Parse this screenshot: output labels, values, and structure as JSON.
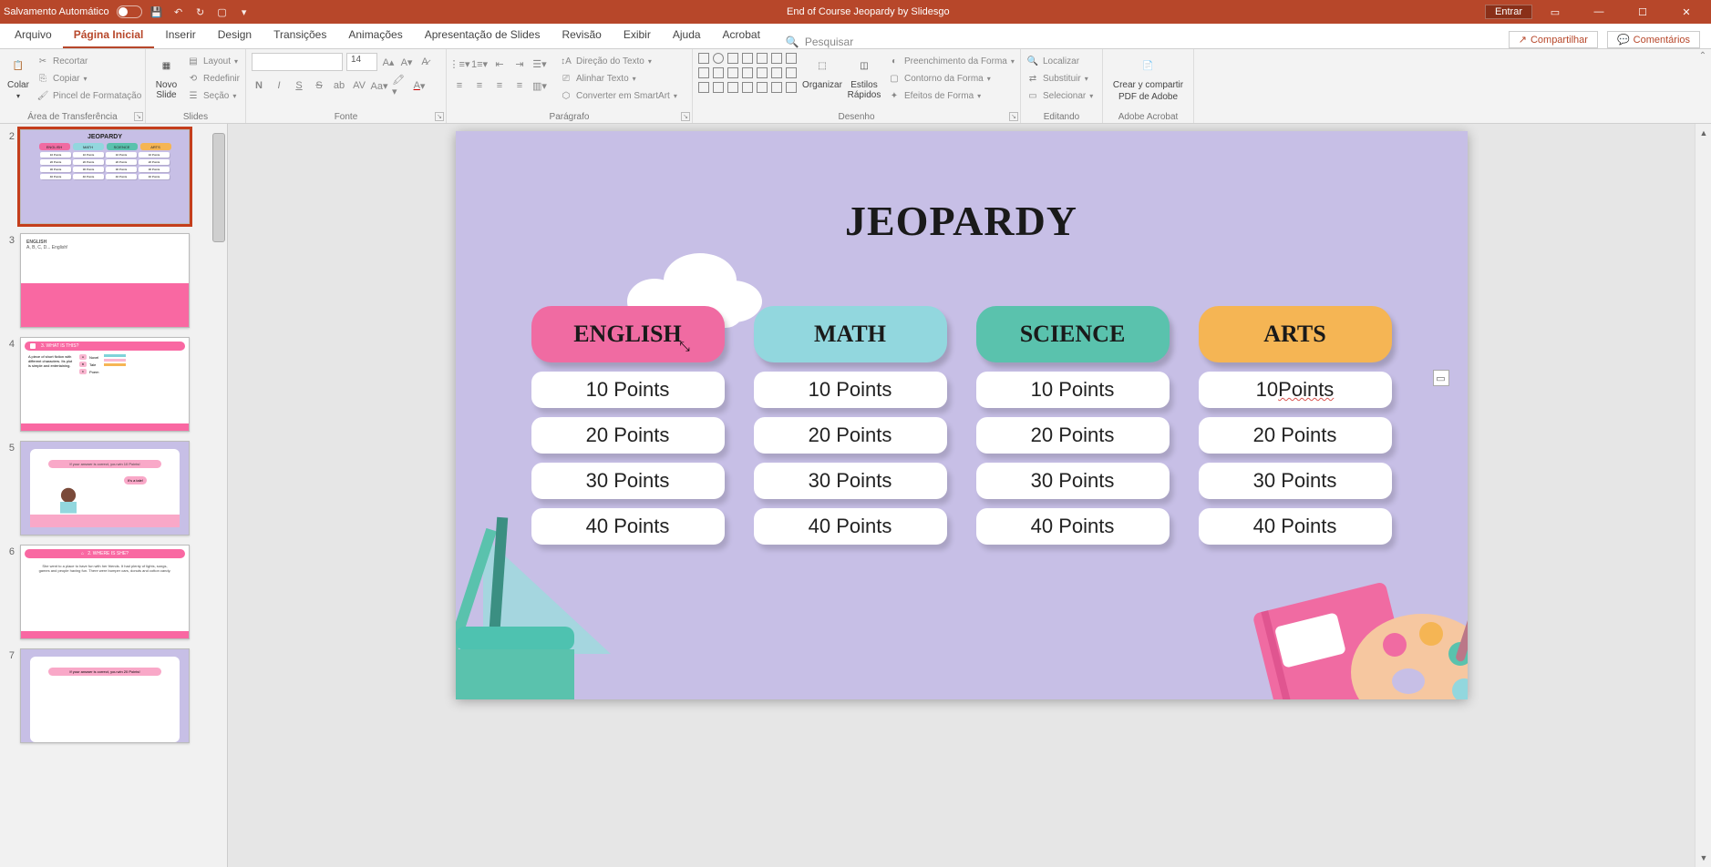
{
  "titlebar": {
    "autosave_label": "Salvamento Automático",
    "doc_title": "End of Course Jeopardy by Slidesgo",
    "signin": "Entrar"
  },
  "tabs": {
    "items": [
      "Arquivo",
      "Página Inicial",
      "Inserir",
      "Design",
      "Transições",
      "Animações",
      "Apresentação de Slides",
      "Revisão",
      "Exibir",
      "Ajuda",
      "Acrobat"
    ],
    "active_index": 1,
    "search_placeholder": "Pesquisar",
    "share": "Compartilhar",
    "comments": "Comentários"
  },
  "ribbon": {
    "clipboard": {
      "label": "Área de Transferência",
      "paste": "Colar",
      "cut": "Recortar",
      "copy": "Copiar",
      "format_painter": "Pincel de Formatação"
    },
    "slides": {
      "label": "Slides",
      "new_slide": "Novo Slide",
      "layout": "Layout",
      "reset": "Redefinir",
      "section": "Seção"
    },
    "font": {
      "label": "Fonte",
      "size": "14"
    },
    "paragraph": {
      "label": "Parágrafo",
      "text_direction": "Direção do Texto",
      "align_text": "Alinhar Texto",
      "smartart": "Converter em SmartArt"
    },
    "drawing": {
      "label": "Desenho",
      "arrange": "Organizar",
      "quick_styles": "Estilos Rápidos",
      "shape_fill": "Preenchimento da Forma",
      "shape_outline": "Contorno da Forma",
      "shape_effects": "Efeitos de Forma"
    },
    "editing": {
      "label": "Editando",
      "find": "Localizar",
      "replace": "Substituir",
      "select": "Selecionar"
    },
    "acrobat": {
      "label": "Adobe Acrobat",
      "create_pdf_l1": "Crear y compartir",
      "create_pdf_l2": "PDF de Adobe"
    }
  },
  "thumbs": {
    "list": [
      {
        "num": "2",
        "title": "JEOPARDY",
        "cats": [
          "ENGLISH",
          "MATH",
          "SCIENCE",
          "ARTS"
        ],
        "pts": [
          "10 Points",
          "20 Points",
          "30 Points",
          "40 Points"
        ]
      },
      {
        "num": "3",
        "title": "ENGLISH",
        "sub": "A, B, C, D... English!"
      },
      {
        "num": "4",
        "title": "3. WHAT IS THIS?",
        "desc": "A piece of short fiction with different characters. Its plot is simple and entertaining.",
        "opts": [
          "Novel",
          "Tale",
          "Poem"
        ]
      },
      {
        "num": "5",
        "banner": "If your answer is correct, you win 10 Points!",
        "bubble": "It's a tale!"
      },
      {
        "num": "6",
        "title": "2. WHERE IS SHE?",
        "body": "She went to a place to have fun with her friends. It had plenty of lights, songs, games and people having fun. There were bumper cars, donuts and cotton candy."
      },
      {
        "num": "7",
        "banner": "If your answer is correct, you win 20 Points!"
      }
    ]
  },
  "slide": {
    "title": "JEOPARDY",
    "categories": [
      {
        "name": "ENGLISH",
        "class": "english"
      },
      {
        "name": "MATH",
        "class": "math"
      },
      {
        "name": "SCIENCE",
        "class": "science"
      },
      {
        "name": "ARTS",
        "class": "arts"
      }
    ],
    "points": [
      "10 Points",
      "20 Points",
      "30 Points",
      "40 Points"
    ],
    "arts_10_display": "10 Points"
  }
}
